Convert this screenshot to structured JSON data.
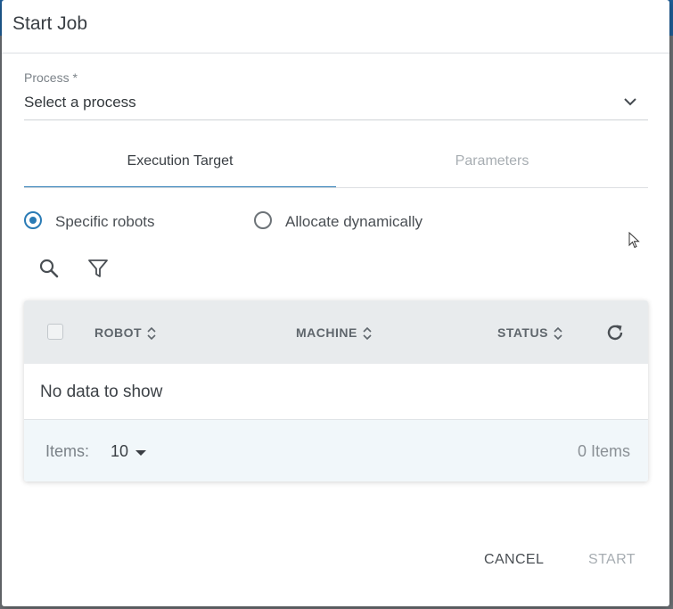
{
  "dialog": {
    "title": "Start Job"
  },
  "process": {
    "label": "Process *",
    "value": "Select a process"
  },
  "tabs": [
    {
      "label": "Execution Target",
      "active": true
    },
    {
      "label": "Parameters",
      "active": false
    }
  ],
  "target_mode": {
    "options": [
      {
        "label": "Specific robots",
        "selected": true
      },
      {
        "label": "Allocate dynamically",
        "selected": false
      }
    ]
  },
  "toolbar": {
    "icons": [
      "search-icon",
      "filter-icon"
    ]
  },
  "grid": {
    "columns": [
      "ROBOT",
      "MACHINE",
      "STATUS"
    ],
    "empty_message": "No data to show",
    "footer": {
      "items_label": "Items:",
      "page_size": "10",
      "count_text": "0 Items"
    }
  },
  "actions": {
    "cancel_label": "CANCEL",
    "start_label": "START"
  },
  "colors": {
    "accent": "#2a7bb5",
    "header_bg": "#e8ebed",
    "footer_bg": "#f1f7fa"
  }
}
